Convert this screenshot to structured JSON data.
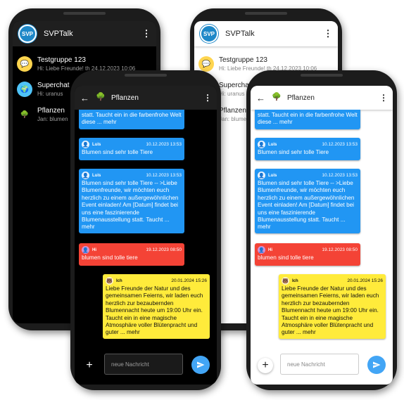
{
  "app": {
    "title": "SVPTalk",
    "logo_text": "SVP"
  },
  "chat_list": [
    {
      "name": "Testgruppe 123",
      "preview": "Hi: Liebe Freunde! th  24.12.2023 10:06"
    },
    {
      "name": "Superchat",
      "preview": "Hi: uranus"
    },
    {
      "name": "Pflanzen",
      "preview": "Jan: blumen"
    }
  ],
  "chat_list_light": [
    {
      "name": "Testgruppe 123",
      "preview": "Hi: Liebe Freunde! th  24.12.2023 10:06"
    },
    {
      "name": "Superchat",
      "preview": "Hi: uranus"
    },
    {
      "name": "Pflanzen",
      "preview": "Jan: blumen"
    }
  ],
  "chat": {
    "title": "Pflanzen",
    "back_icon": "arrow-left-icon",
    "messages": [
      {
        "text": "statt. Taucht ein in die farbenfrohe Welt diese ... mehr"
      },
      {
        "sender": "Luis",
        "time": "10.12.2023 13:53",
        "text": "Blumen sind sehr tolle Tiere"
      },
      {
        "sender": "Luis",
        "time": "10.12.2023 13:53",
        "text": "Blumen sind sehr tolle Tiere -- >Liebe Blumenfreunde, wir möchten euch herzlich zu einem außergewöhnlichen Event einladen! Am [Datum] findet bei uns eine faszinierende Blumenausstellung statt. Taucht ... mehr"
      },
      {
        "sender": "Hi",
        "time": "19.12.2023 08:50",
        "text": "blumen sind tolle tiere"
      },
      {
        "sender": "Ich",
        "time": "20.01.2024 15:26",
        "text": "Liebe Freunde der Natur und des gemeinsamen Feierns, wir laden euch herzlich zur bezaubernden Blumennacht heute um 19:00 Uhr ein. Taucht ein in eine magische Atmosphäre voller Blütenpracht und guter ... mehr"
      }
    ],
    "input_placeholder": "neue Nachricht",
    "plus_label": "+"
  },
  "colors": {
    "blue": "#2196f3",
    "red": "#f44336",
    "yellow": "#ffeb3b",
    "send": "#42a5f5"
  }
}
